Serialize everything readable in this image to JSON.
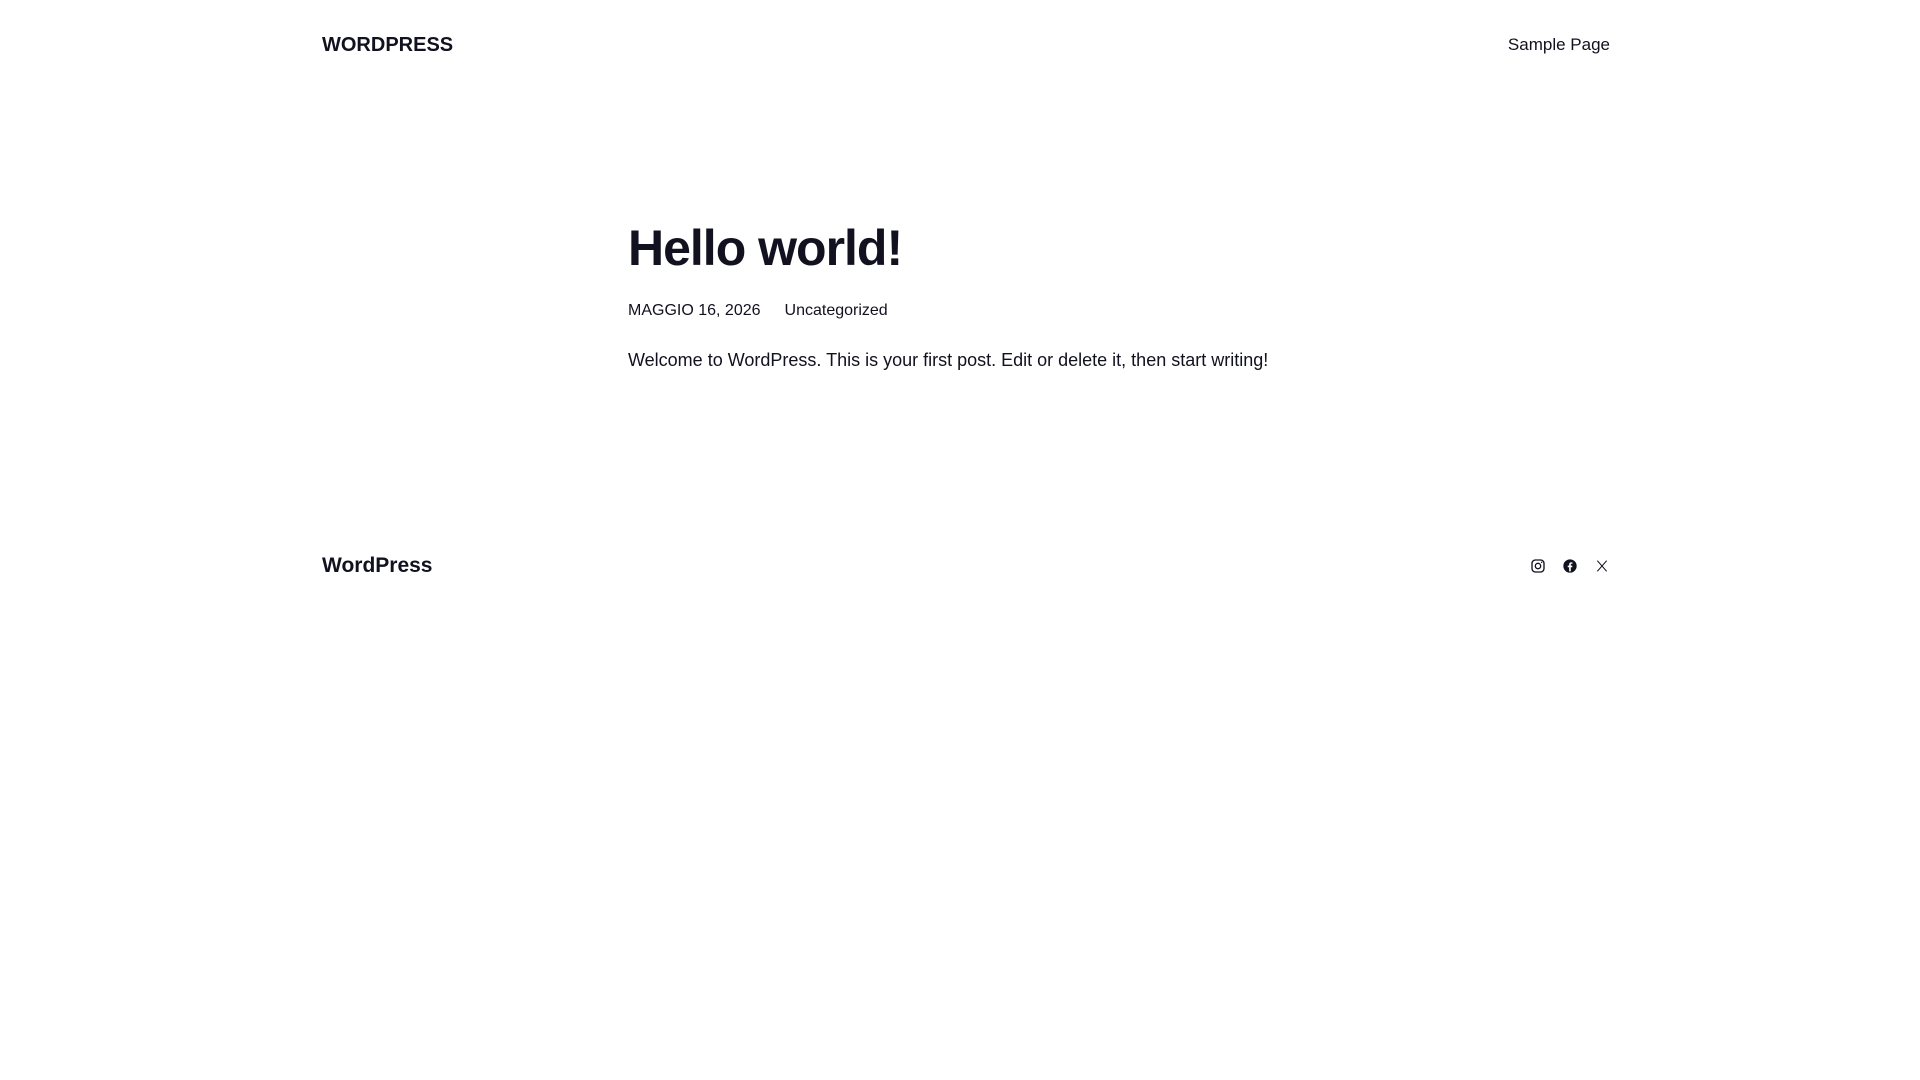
{
  "header": {
    "site_title": "WORDPRESS",
    "nav": [
      {
        "label": "Sample Page"
      }
    ]
  },
  "post": {
    "title": "Hello world!",
    "date": "MAGGIO 16, 2026",
    "category": "Uncategorized",
    "content": "Welcome to WordPress. This is your first post. Edit or delete it, then start writing!"
  },
  "footer": {
    "site_title": "WordPress",
    "social_icons": [
      "instagram-icon",
      "facebook-icon",
      "x-icon"
    ]
  },
  "colors": {
    "text": "#11111f",
    "background": "#ffffff"
  }
}
